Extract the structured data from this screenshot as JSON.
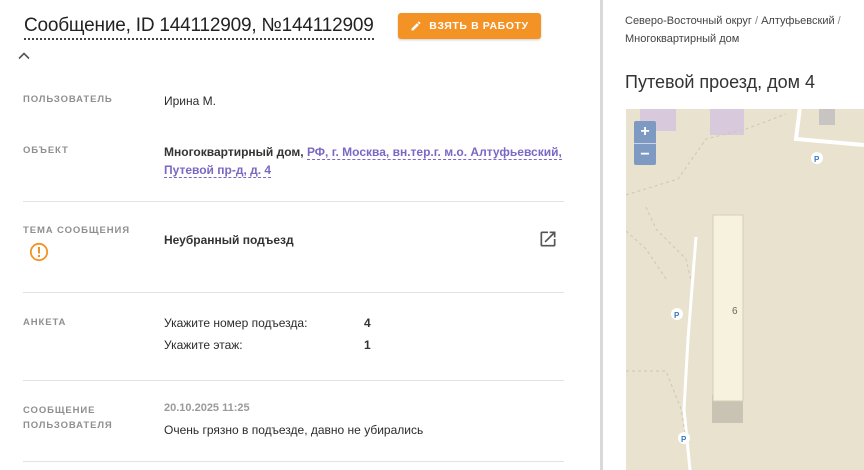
{
  "header": {
    "title": "Сообщение, ID 144112909, №144112909",
    "take_button_label": "ВЗЯТЬ В РАБОТУ",
    "accent_color": "#f39225"
  },
  "fields": {
    "user": {
      "label": "ПОЛЬЗОВАТЕЛЬ",
      "value": "Ирина М."
    },
    "object": {
      "label": "ОБЪЕКТ",
      "type": "Многоквартирный дом,",
      "address_line1": "РФ, г. Москва, вн.тер.г. м.о. Алтуфьевский,",
      "address_line2": "Путевой пр-д, д. 4"
    },
    "topic": {
      "label": "ТЕМА СООБЩЕНИЯ",
      "value": "Неубранный подъезд"
    },
    "survey": {
      "label": "АНКЕТА",
      "rows": [
        {
          "q": "Укажите номер подъезда:",
          "a": "4"
        },
        {
          "q": "Укажите этаж:",
          "a": "1"
        }
      ]
    },
    "message": {
      "label_line1": "СООБЩЕНИЕ",
      "label_line2": "ПОЛЬЗОВАТЕЛЯ",
      "date": "20.10.2025 11:25",
      "text": "Очень грязно в подъезде, давно не убирались"
    }
  },
  "sidebar": {
    "breadcrumb": [
      "Северо-Восточный округ",
      "Алтуфьевский",
      "Многоквартирный дом"
    ],
    "breadcrumb_separator": "/",
    "address_title": "Путевой проезд, дом 4",
    "map": {
      "zoom_in": "+",
      "zoom_out": "−",
      "building_number": "6",
      "parking_label": "P"
    }
  }
}
